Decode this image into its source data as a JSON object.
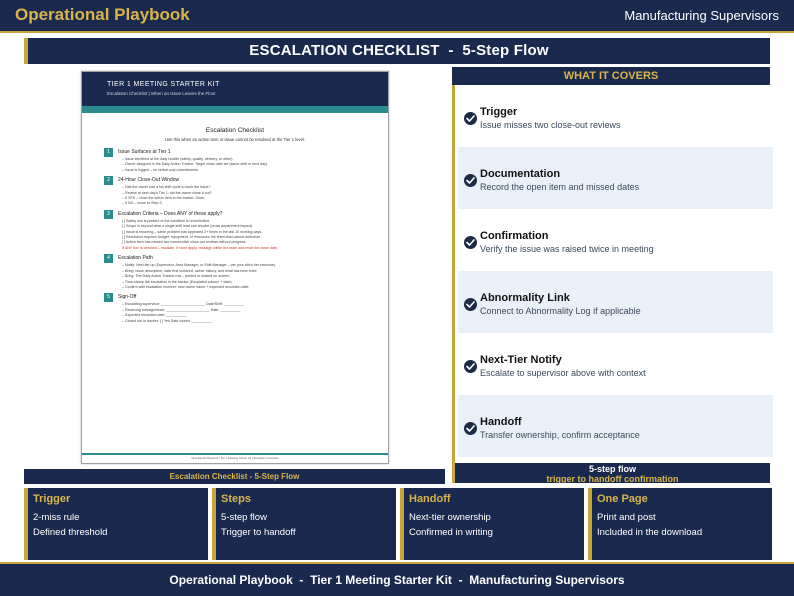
{
  "header": {
    "brand": "Operational Playbook",
    "audience": "Manufacturing Supervisors"
  },
  "title": "ESCALATION CHECKLIST  -  5-Step Flow",
  "document": {
    "kit": "TIER 1 MEETING STARTER KIT",
    "subtitle": "Escalation Checklist  |  When an Issue Leaves the Floor",
    "title": "Escalation Checklist",
    "intro": "Use this when an action item or issue cannot be resolved at the Tier 1 level.",
    "steps": [
      {
        "num": "1",
        "heading": "Issue Surfaces at Tier 1",
        "lines": [
          "– Issue identified at the daily huddle (safety, quality, delivery, or other).",
          "– Owner assigned in the Daily Action Tracker. Target close date set (same shift or next day).",
          "– Issue is logged – no verbal-only commitments."
        ]
      },
      {
        "num": "2",
        "heading": "24-Hour Close-Out Window",
        "lines": [
          "– Has the owner had a full shift cycle to work the issue?",
          "– Review at next day's Tier 1: did the owner close it out?",
          "– If YES – close the action item in the tracker. Done.",
          "– If NO – move to Step 3."
        ]
      },
      {
        "num": "3",
        "heading": "Escalation Criteria – Does ANY of these apply?",
        "lines": [
          "[ ] Safety risk is present or the condition is uncontrolled.",
          "[ ] Scope is beyond what a single shift lead can resolve (cross-department impact).",
          "[ ] Issue is recurring – same problem has appeared 2+ times in the last 10 working days.",
          "[ ] Resolution requires budget, equipment, or resources the team lead cannot authorize.",
          "[ ] Action item has missed two consecutive close-out reviews without progress."
        ],
        "note": "If ANY box is checked – escalate. If none apply, reassign within the team and reset the close date."
      },
      {
        "num": "4",
        "heading": "Escalation Path",
        "lines": [
          "– Notify: Next tier up (Supervisor, Area Manager, or Shift Manager – per your site's tier structure).",
          "– Bring: Issue description, date first surfaced, owner history, and what has been tried.",
          "– Bring: The Daily Action Tracker row – printed or shared on screen.",
          "– Time-stamp the escalation in the tracker (Escalated column + date).",
          "– Confirm with escalation receiver: new owner name + expected resolution date."
        ]
      },
      {
        "num": "5",
        "heading": "Sign-Off",
        "lines": [
          "– Escalating supervisor: ______________________ Date/Shift: __________",
          "– Receiving manager/lead: ______________________ Date: __________",
          "– Expected resolution date: __________",
          "– Closed out in tracker: [ ] Yes  Date closed: __________"
        ]
      }
    ],
    "footer": "Operational Playbook  |  Tier 1 Meeting Starter Kit  |  Escalation Checklist",
    "caption": "Escalation Checklist - 5-Step Flow"
  },
  "covers": {
    "heading": "WHAT IT COVERS",
    "items": [
      {
        "title": "Trigger",
        "desc": "Issue misses two close-out reviews",
        "icon": "check-circle-icon"
      },
      {
        "title": "Documentation",
        "desc": "Record the open item and missed dates",
        "icon": "check-circle-icon"
      },
      {
        "title": "Confirmation",
        "desc": "Verify the issue was raised twice in meeting",
        "icon": "check-circle-icon"
      },
      {
        "title": "Abnormality Link",
        "desc": "Connect to Abnormality Log if applicable",
        "icon": "check-circle-icon"
      },
      {
        "title": "Next-Tier Notify",
        "desc": "Escalate to supervisor above with context",
        "icon": "check-circle-icon"
      },
      {
        "title": "Handoff",
        "desc": "Transfer ownership, confirm acceptance",
        "icon": "check-circle-icon"
      }
    ],
    "footer_line1": "5-step flow",
    "footer_line2": "trigger to handoff confirmation"
  },
  "cards": [
    {
      "title": "Trigger",
      "lines": [
        "2-miss rule",
        "Defined threshold"
      ]
    },
    {
      "title": "Steps",
      "lines": [
        "5-step flow",
        "Trigger to handoff"
      ]
    },
    {
      "title": "Handoff",
      "lines": [
        "Next-tier ownership",
        "Confirmed in writing"
      ]
    },
    {
      "title": "One Page",
      "lines": [
        "Print and post",
        "Included in the download"
      ]
    }
  ],
  "footer": "Operational Playbook  -  Tier 1 Meeting Starter Kit  -  Manufacturing Supervisors",
  "colors": {
    "navy": "#1a2a4e",
    "gold": "#c8a43e",
    "teal": "#2a8c8c",
    "light_row": "#eaf0f8"
  }
}
